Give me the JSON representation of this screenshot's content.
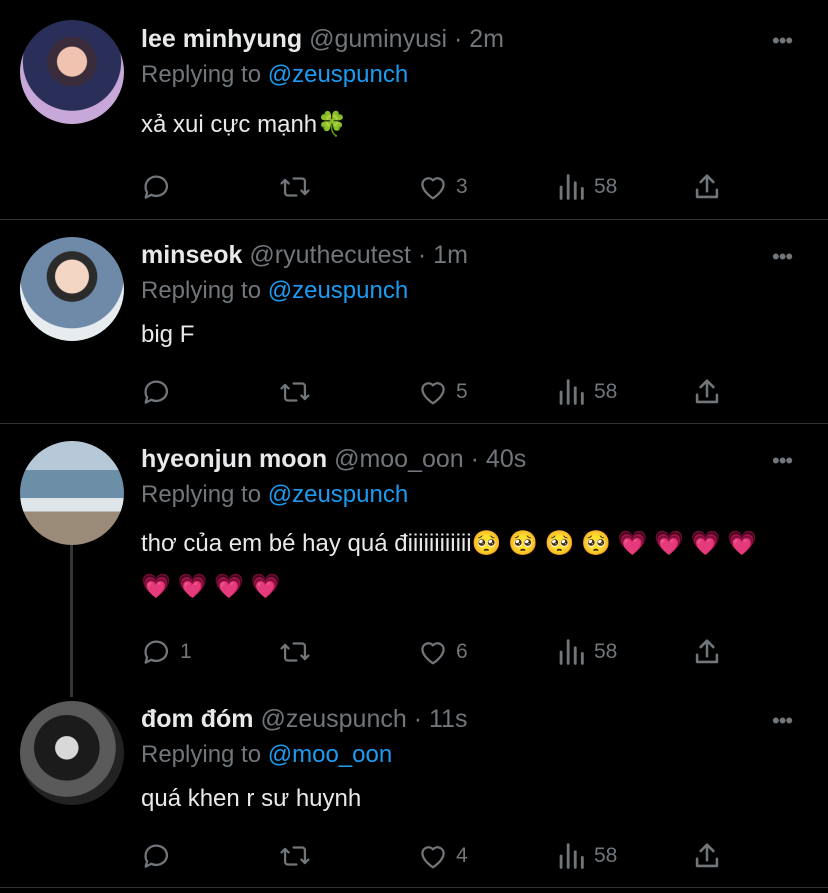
{
  "tweets": [
    {
      "name": "lee minhyung",
      "handle": "@guminyusi",
      "time": "· 2m",
      "replying_prefix": "Replying to",
      "replying_to": "@zeuspunch",
      "text_lines": [
        "xả xui cực mạnh🍀"
      ],
      "replies": "",
      "retweets": "",
      "likes": "3",
      "views": "58"
    },
    {
      "name": "minseok",
      "handle": "@ryuthecutest",
      "time": "· 1m",
      "replying_prefix": "Replying to",
      "replying_to": "@zeuspunch",
      "text_lines": [
        "big F"
      ],
      "replies": "",
      "retweets": "",
      "likes": "5",
      "views": "58"
    },
    {
      "name": "hyeonjun moon",
      "handle": "@moo_oon",
      "time": "· 40s",
      "replying_prefix": "Replying to",
      "replying_to": "@zeuspunch",
      "text_lines": [
        "thơ của em bé hay quá điiiiiiiiiiii🥺 🥺 🥺 🥺 💗 💗 💗 💗",
        "💗 💗 💗 💗"
      ],
      "replies": "1",
      "retweets": "",
      "likes": "6",
      "views": "58"
    },
    {
      "name": "đom đóm",
      "handle": "@zeuspunch",
      "time": "· 11s",
      "replying_prefix": "Replying to",
      "replying_to": "@moo_oon",
      "text_lines": [
        "quá khen r sư huynh"
      ],
      "replies": "",
      "retweets": "",
      "likes": "4",
      "views": "58"
    }
  ],
  "more_glyph": "•••",
  "colors": {
    "background": "#000000",
    "text": "#e7e9ea",
    "muted": "#71767b",
    "link": "#1d9bf0",
    "divider": "#2f3336"
  },
  "icons": [
    "reply-icon",
    "retweet-icon",
    "like-icon",
    "views-icon",
    "share-icon",
    "more-icon"
  ]
}
